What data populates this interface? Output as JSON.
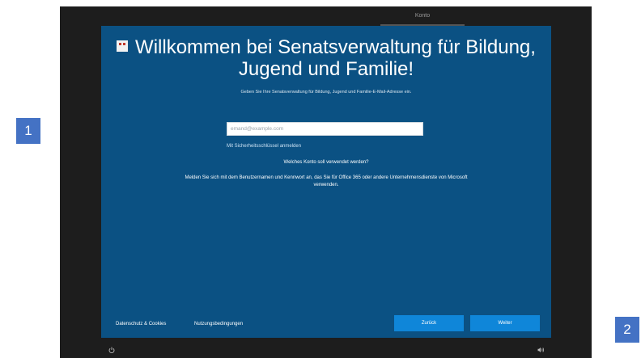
{
  "markers": {
    "left": "1",
    "right": "2"
  },
  "topbar": {
    "tab_label": "Konto"
  },
  "panel": {
    "title": "Willkommen bei Senatsverwaltung für Bildung, Jugend und Familie!",
    "subtitle": "Geben Sie Ihre Senatsverwaltung für Bildung, Jugend und Familie-E-Mail-Adresse ein.",
    "email_placeholder": "emand@example.com",
    "email_value": "",
    "security_key_link": "Mit Sicherheitsschlüssel anmelden",
    "question": "Welches Konto soll verwendet werden?",
    "info": "Melden Sie sich mit dem Benutzernamen und Kennwort an, das Sie für Office 365 oder andere Unternehmensdienste von Microsoft verwenden.",
    "title_icon": "org-logo-icon"
  },
  "footer": {
    "privacy_link": "Datenschutz & Cookies",
    "terms_link": "Nutzungsbedingungen",
    "back_label": "Zurück",
    "next_label": "Weiter"
  },
  "statusbar": {
    "power_icon": "power-icon",
    "volume_icon": "volume-icon"
  },
  "colors": {
    "panel_bg": "#0b5183",
    "button_bg": "#0f86d9",
    "device_bg": "#1d1d1d",
    "marker_bg": "#4472c4"
  }
}
